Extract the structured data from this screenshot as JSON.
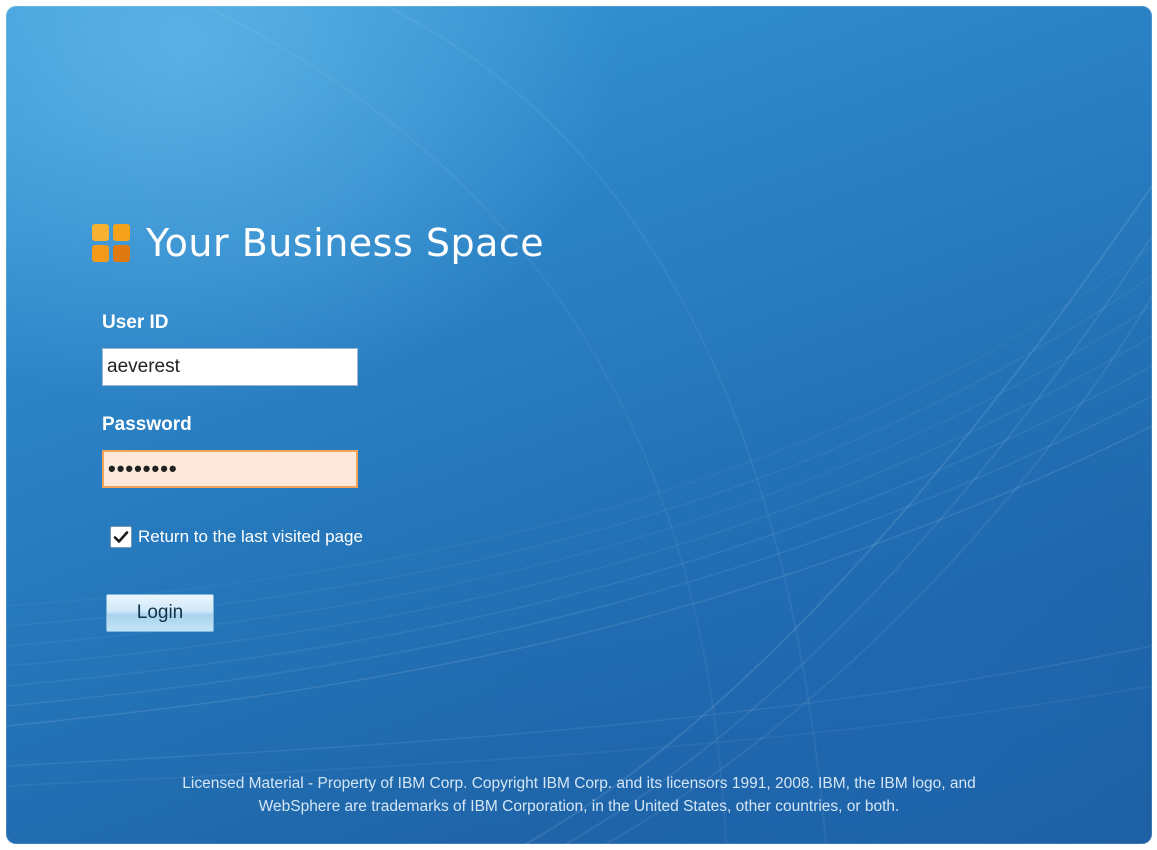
{
  "app": {
    "title": "Your Business Space",
    "logo_icon": "business-space-logo-icon",
    "colors": {
      "background_top": "#3a9ad6",
      "background_bottom": "#1d5e9f",
      "logo_orange": "#f7a21b",
      "logo_dark_orange": "#e07a10",
      "field_focus_border": "#f2a35a"
    }
  },
  "login_form": {
    "user_id_label": "User ID",
    "user_id_value": "aeverest",
    "password_label": "Password",
    "password_value": "secret12",
    "remember_checked": true,
    "remember_label": "Return to the last visited page",
    "login_button": "Login"
  },
  "footer": {
    "line1": "Licensed Material - Property of IBM Corp. Copyright IBM Corp. and its licensors 1991, 2008. IBM, the IBM logo, and",
    "line2": "WebSphere are trademarks of IBM Corporation, in the United States, other countries, or both."
  }
}
